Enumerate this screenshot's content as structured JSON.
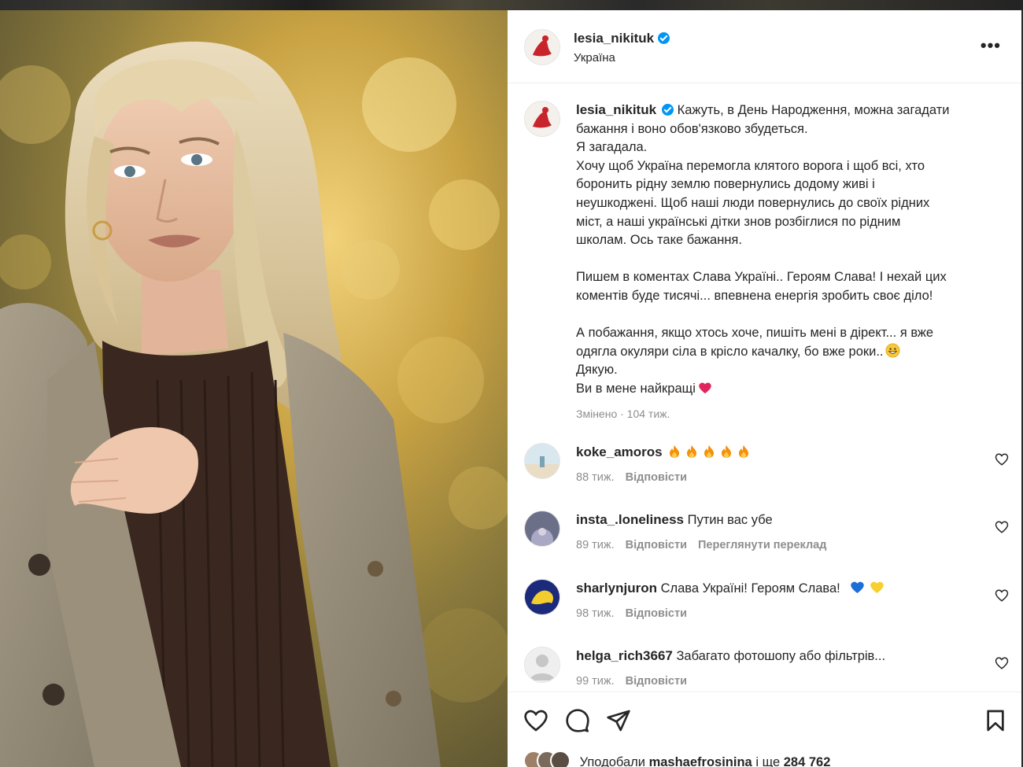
{
  "post": {
    "username": "lesia_nikituk",
    "location": "Україна"
  },
  "caption": {
    "lines": [
      "Кажуть, в День Народження, можна загадати",
      "бажання і воно обов'язково збудеться.",
      "Я загадала.",
      "Хочу щоб Україна перемогла клятого ворога і щоб всі, хто",
      "боронить рідну землю повернулись додому живі і",
      "неушкоджені. Щоб наші люди повернулись до своїх рідних",
      "міст, а наші українські дітки знов розбіглися по рідним",
      "школам. Ось таке бажання.",
      "",
      "Пишем в коментах Слава Україні.. Героям Слава! І нехай цих",
      "коментів буде тисячі... впевнена енергія зробить своє діло!",
      "",
      "А побажання, якщо хтось хоче, пишіть мені в дірект... я вже",
      "одягла окуляри сіла в крісло качалку, бо вже роки..",
      "Дякую.",
      "Ви в мене найкращі"
    ],
    "edited": "Змінено · 104 тиж."
  },
  "comments": [
    {
      "username": "koke_amoros",
      "text": "",
      "fire_count": 5,
      "time": "88 тиж.",
      "reply": "Відповісти",
      "extra": ""
    },
    {
      "username": "insta_.loneliness",
      "text": "Путин вас убе",
      "fire_count": 0,
      "time": "89 тиж.",
      "reply": "Відповісти",
      "extra": "Переглянути переклад"
    },
    {
      "username": "sharlynjuron",
      "text": "Слава Україні! Героям Слава!",
      "fire_count": 0,
      "time": "98 тиж.",
      "reply": "Відповісти",
      "extra": ""
    },
    {
      "username": "helga_rich3667",
      "text": "Забагато фотошопу або фільтрів...",
      "fire_count": 0,
      "time": "99 тиж.",
      "reply": "Відповісти",
      "extra": ""
    }
  ],
  "likes": {
    "prefix": "Уподобали",
    "user": "mashaefrosinina",
    "middle": "і ще",
    "count": "284 762"
  },
  "colors": {
    "verified": "#0095f6",
    "text": "#262626",
    "muted": "#8e8e8e",
    "heart_red": "#e0245e",
    "blue_heart": "#1d6fd8",
    "yellow_heart": "#f7cf2e"
  },
  "icons": [
    "verified-badge-icon",
    "more-options-icon",
    "like-icon",
    "comment-icon",
    "share-icon",
    "save-icon",
    "fire-emoji-icon",
    "grinning-emoji-icon",
    "red-heart-emoji-icon",
    "blue-heart-emoji-icon",
    "yellow-heart-emoji-icon"
  ]
}
